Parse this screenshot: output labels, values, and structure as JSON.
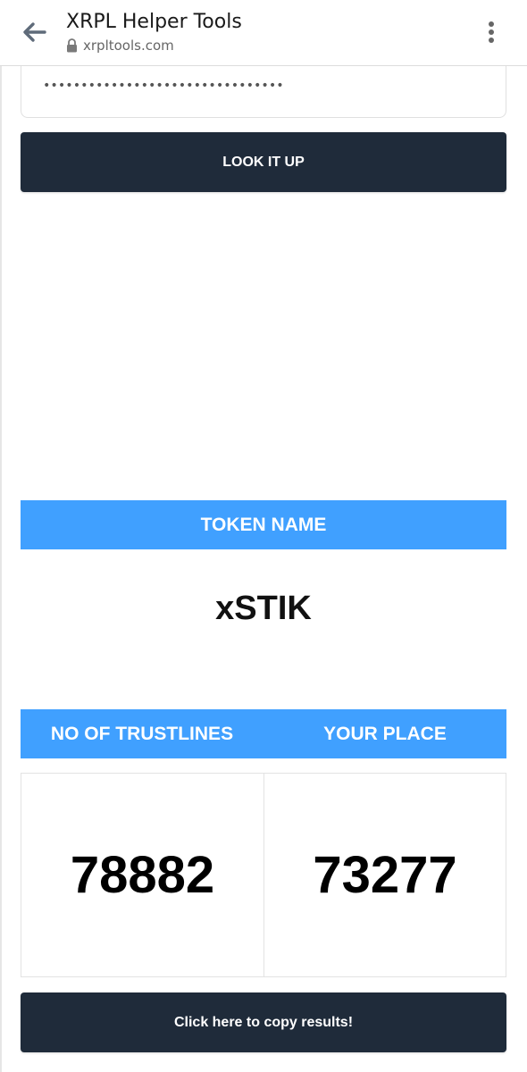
{
  "browser": {
    "title": "XRPL Helper Tools",
    "url": "xrpltools.com",
    "back_icon": "arrow-left-icon",
    "lock_icon": "lock-icon",
    "menu_icon": "more-vertical-icon"
  },
  "form": {
    "password_value": "••••••••••••••••••••••••••••••••",
    "lookup_label": "LOOK IT UP"
  },
  "results": {
    "token_header": "TOKEN NAME",
    "token_name": "xSTIK",
    "trustlines_header": "NO OF TRUSTLINES",
    "place_header": "YOUR PLACE",
    "trustlines_count": "78882",
    "your_place": "73277",
    "copy_label": "Click here to copy results!"
  },
  "colors": {
    "accent_blue": "#40a0ff",
    "dark_button": "#1f2b3a"
  }
}
